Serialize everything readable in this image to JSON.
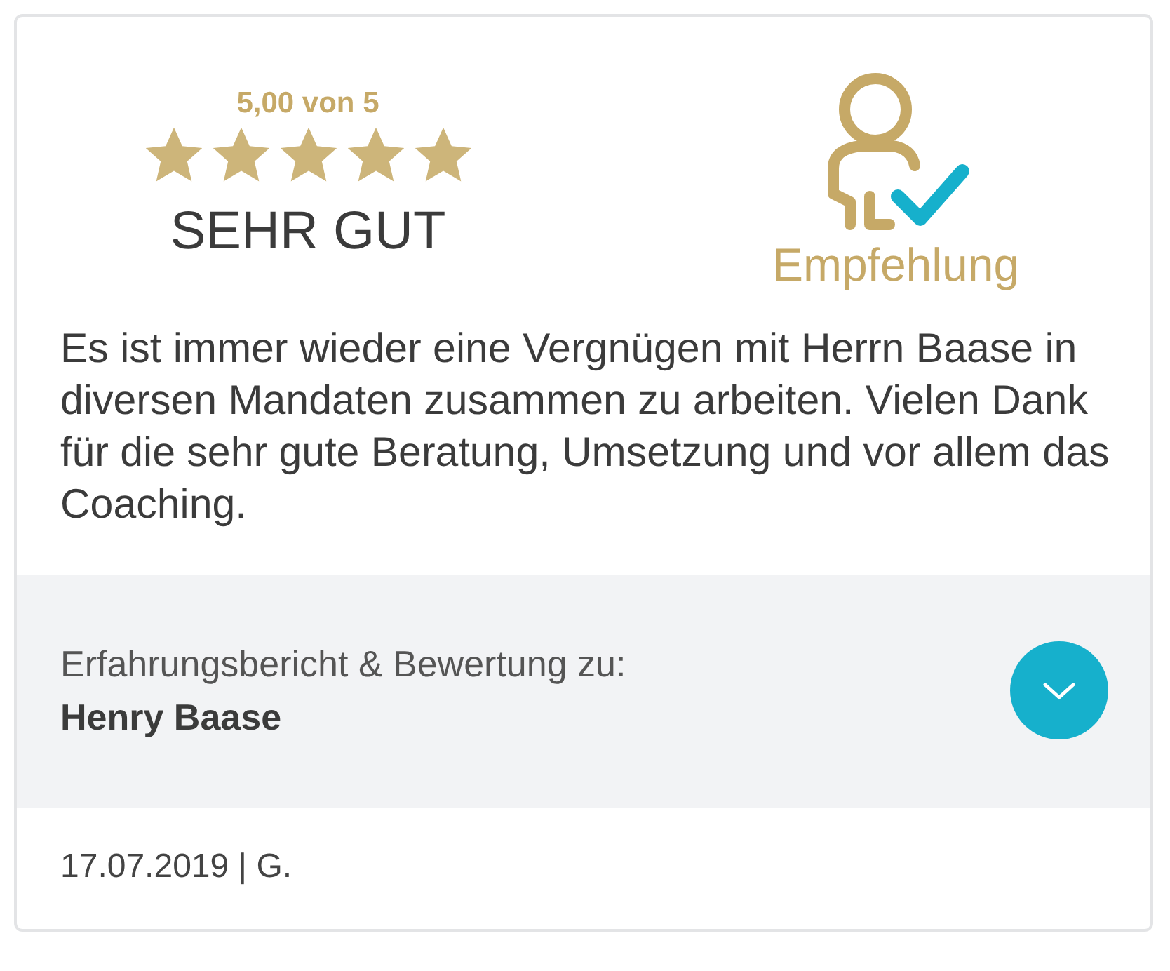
{
  "rating": {
    "score": "5,00 von 5",
    "stars": 5,
    "verdict": "SEHR GUT"
  },
  "recommendation": {
    "label": "Empfehlung"
  },
  "review": "Es ist immer wieder eine Vergnügen mit Herrn Baase in diversen Mandaten zusammen zu arbeiten. Vielen Dank für die sehr gute Beratung, Umsetzung und vor allem das Coaching.",
  "subject": {
    "caption": "Erfahrungsbericht & Bewertung zu:",
    "name": "Henry Baase",
    "expanded": false
  },
  "footer": "17.07.2019 | G."
}
